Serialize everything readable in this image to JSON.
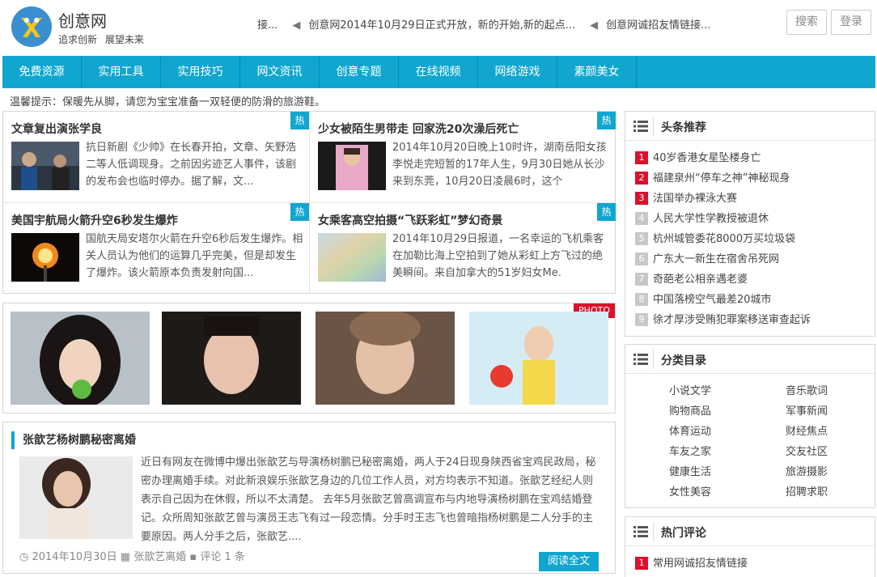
{
  "site": {
    "name": "创意网",
    "slogan": "追求创新 展望未来"
  },
  "ticker": [
    "接...",
    "创意网2014年10月29日正式开放，新的开始,新的起点...",
    "创意网诚招友情链接..."
  ],
  "header_buttons": {
    "search": "搜索",
    "login": "登录"
  },
  "nav": [
    "免费资源",
    "实用工具",
    "实用技巧",
    "网文资讯",
    "创意专题",
    "在线视频",
    "网络游戏",
    "素颜美女"
  ],
  "tip": "温馨提示：保暖先从脚，请您为宝宝准备一双轻便的防滑的旅游鞋。",
  "hot_badge": "热",
  "cards": [
    {
      "title": "文章复出演张学良",
      "desc": "抗日新剧《少帅》在长春开拍，文章、矢野浩二等人低调现身。之前因劣迹艺人事件，该剧的发布会也临时停办。据了解，文..."
    },
    {
      "title": "少女被陌生男带走 回家洗20次澡后死亡",
      "desc": "2014年10月20日晚上10时许，湖南岳阳女孩李悦走完短暂的17年人生，9月30日她从长沙来到东莞，10月20日凌晨6时，这个"
    },
    {
      "title": "美国宇航局火箭升空6秒发生爆炸",
      "desc": "国航天局安塔尔火箭在升空6秒后发生爆炸。相关人员认为他们的运算几乎完美，但是却发生了爆炸。该火箭原本负责发射向国..."
    },
    {
      "title": "女乘客高空拍摄“飞跃彩虹”梦幻奇景",
      "desc": "2014年10月29日报道，一名幸运的飞机乘客在加勒比海上空拍到了她从彩虹上方飞过的绝美瞬间。来自加拿大的51岁妇女Me."
    }
  ],
  "photo_badge": "PHOTO",
  "article": {
    "title": "张歆艺杨树鹏秘密离婚",
    "text": "近日有网友在微博中爆出张歆艺与导演杨树鹏已秘密离婚，两人于24日现身陕西省宝鸡民政局，秘密办理离婚手续。对此新浪娱乐张歆艺身边的几位工作人员，对方均表示不知道。张歆艺经纪人则表示自己因为在休假，所以不太清楚。 去年5月张歆艺曾高调宣布与内地导演杨树鹏在宝鸡结婚登记。众所周知张歆艺曾与演员王志飞有过一段恋情。分手时王志飞也曾暗指杨树鹏是二人分手的主要原因。两人分手之后，张歆艺....",
    "date": "2014年10月30日",
    "tag": "张歆艺离婚",
    "comments": "评论 1 条",
    "readmore": "阅读全文"
  },
  "sidebar": {
    "top_title": "头条推荐",
    "top_items": [
      {
        "n": "1",
        "text": "40岁香港女星坠楼身亡"
      },
      {
        "n": "2",
        "text": "福建泉州“停车之神”神秘现身"
      },
      {
        "n": "3",
        "text": "法国举办裸泳大赛"
      },
      {
        "n": "4",
        "text": "人民大学性学教授被退休"
      },
      {
        "n": "5",
        "text": "杭州城管委花8000万买垃圾袋"
      },
      {
        "n": "6",
        "text": "广东大一新生在宿舍吊死网"
      },
      {
        "n": "7",
        "text": "奇葩老公相亲遇老婆"
      },
      {
        "n": "8",
        "text": "中国落榜空气最差20城市"
      },
      {
        "n": "9",
        "text": "徐才厚涉受贿犯罪案移送审查起诉"
      }
    ],
    "cat_title": "分类目录",
    "categories": [
      "小说文学",
      "音乐歌词",
      "购物商品",
      "军事新闻",
      "体育运动",
      "财经焦点",
      "车友之家",
      "交友社区",
      "健康生活",
      "旅游摄影",
      "女性美容",
      "招聘求职"
    ],
    "comment_title": "热门评论",
    "comment_items": [
      {
        "n": "1",
        "text": "常用网诚招友情链接"
      }
    ]
  },
  "colors": {
    "accent": "#10a6cf",
    "rank_red": "#d9112b",
    "rank_gray": "#c8c8c8"
  }
}
